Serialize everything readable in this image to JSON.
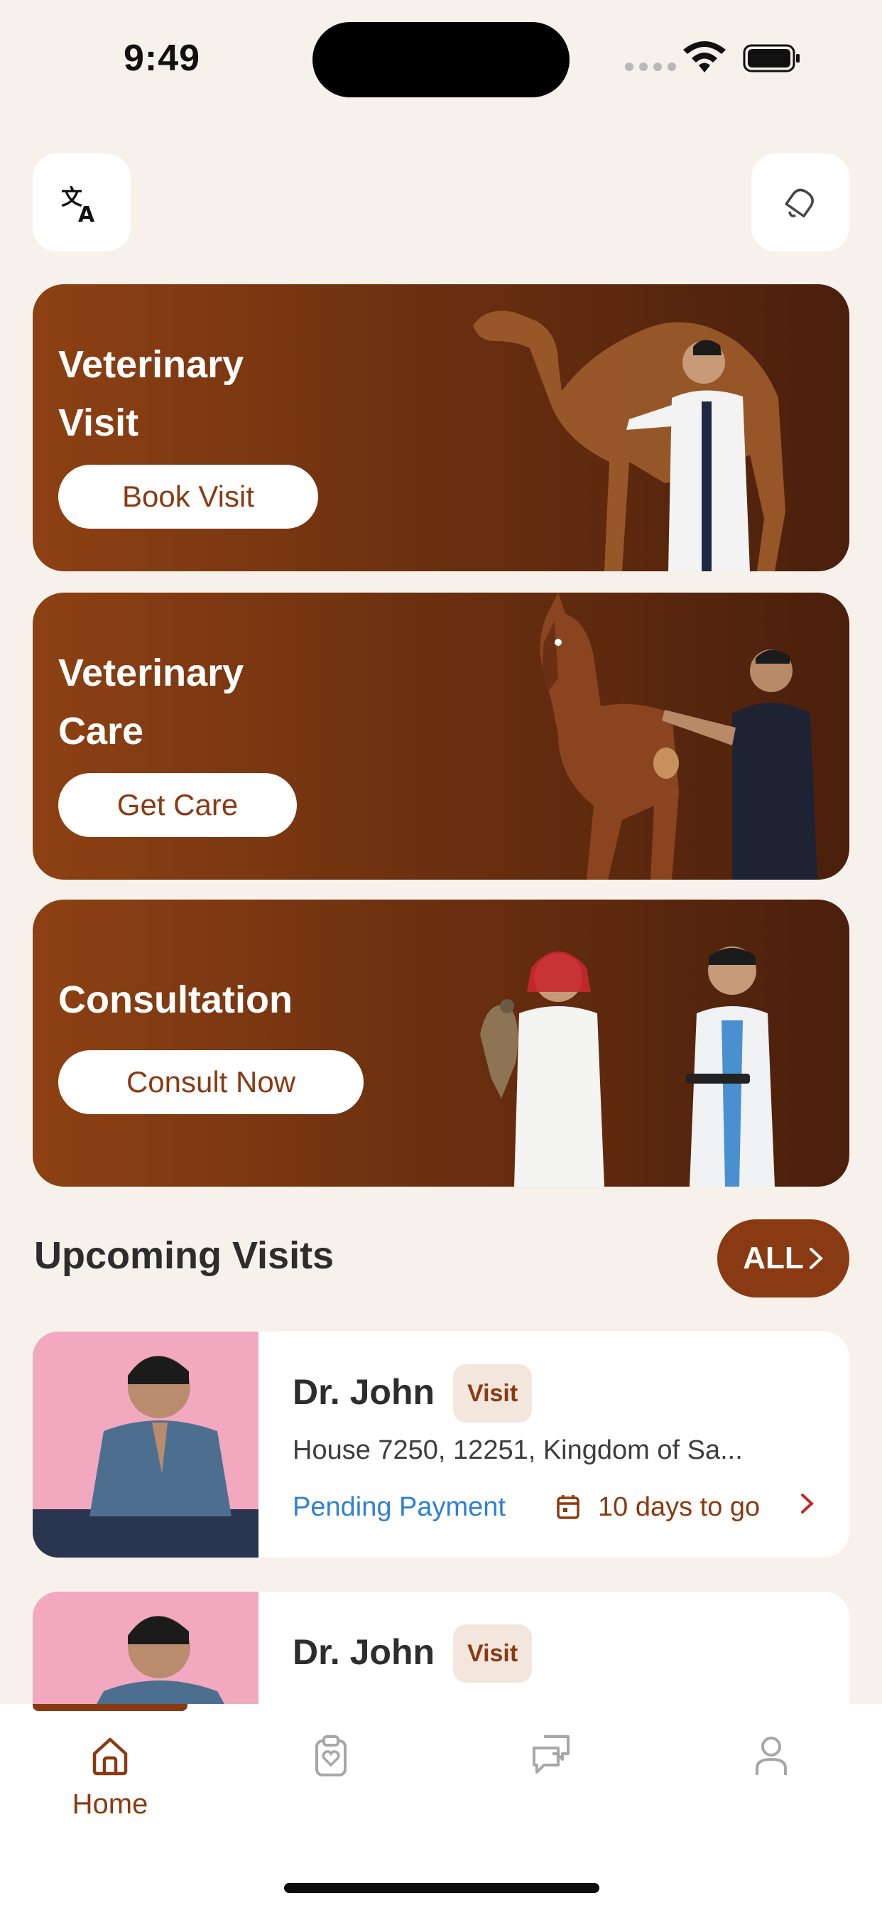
{
  "status_bar": {
    "time": "9:49"
  },
  "top_bar": {
    "language_icon": "translate-icon",
    "notification_icon": "bell-icon"
  },
  "services": [
    {
      "title_line1": "Veterinary",
      "title_line2": "Visit",
      "cta": "Book Visit"
    },
    {
      "title_line1": "Veterinary",
      "title_line2": "Care",
      "cta": "Get Care"
    },
    {
      "title_line1": "Consultation",
      "title_line2": "",
      "cta": "Consult Now"
    }
  ],
  "upcoming": {
    "title": "Upcoming Visits",
    "all_label": "ALL",
    "visits": [
      {
        "name": "Dr. John",
        "tag": "Visit",
        "address": "House 7250, 12251, Kingdom of Sa...",
        "status": "Pending Payment",
        "days": "10 days to go"
      },
      {
        "name": "Dr. John",
        "tag": "Visit"
      }
    ]
  },
  "tabbar": {
    "tabs": [
      {
        "label": "Home",
        "icon": "home-icon",
        "active": true
      },
      {
        "label": "",
        "icon": "clipboard-heart-icon",
        "active": false
      },
      {
        "label": "",
        "icon": "chat-icon",
        "active": false
      },
      {
        "label": "",
        "icon": "profile-icon",
        "active": false
      }
    ]
  },
  "colors": {
    "accent": "#8a3a12",
    "background": "#f6f1ea",
    "status_blue": "#2f7fd6",
    "chevron_red": "#c02b2b"
  }
}
